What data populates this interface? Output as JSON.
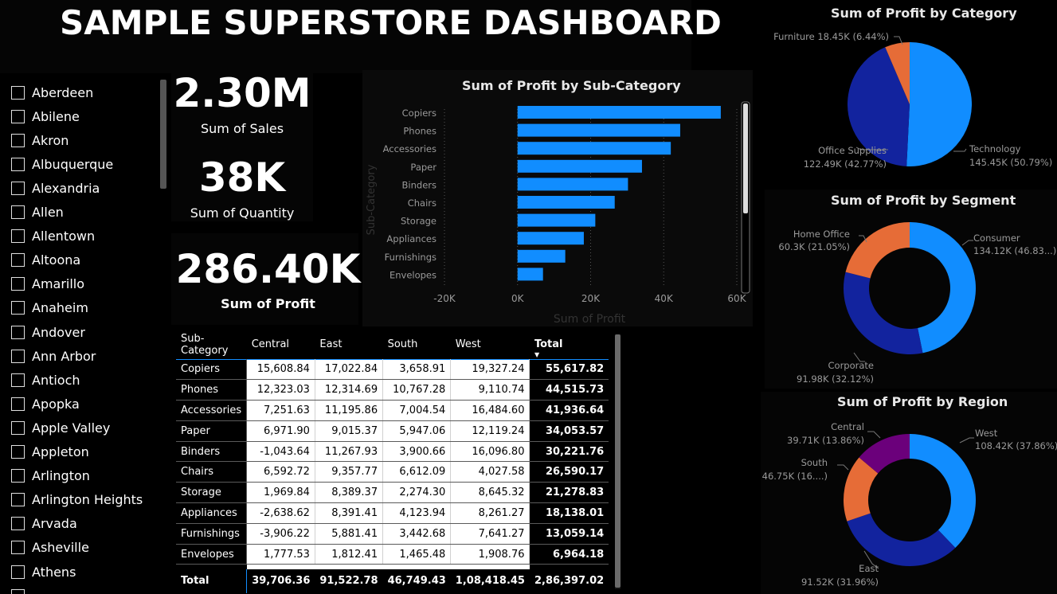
{
  "title": "SAMPLE SUPERSTORE DASHBOARD",
  "cities": [
    "Aberdeen",
    "Abilene",
    "Akron",
    "Albuquerque",
    "Alexandria",
    "Allen",
    "Allentown",
    "Altoona",
    "Amarillo",
    "Anaheim",
    "Andover",
    "Ann Arbor",
    "Antioch",
    "Apopka",
    "Apple Valley",
    "Appleton",
    "Arlington",
    "Arlington Heights",
    "Arvada",
    "Asheville",
    "Athens"
  ],
  "kpis": {
    "sales_value": "2.30M",
    "sales_label": "Sum of Sales",
    "quantity_value": "38K",
    "quantity_label": "Sum of Quantity",
    "profit_value": "286.40K",
    "profit_label": "Sum of Profit"
  },
  "colors": {
    "light_blue": "#118dff",
    "dark_blue": "#12239e",
    "orange": "#e66c37",
    "purple": "#6b007b",
    "background": "#000000"
  },
  "chart_data": [
    {
      "type": "bar",
      "title": "Sum of Profit by Sub-Category",
      "xlabel": "Sum of Profit",
      "ylabel": "Sub-Category",
      "categories": [
        "Copiers",
        "Phones",
        "Accessories",
        "Paper",
        "Binders",
        "Chairs",
        "Storage",
        "Appliances",
        "Furnishings",
        "Envelopes"
      ],
      "values": [
        55617.82,
        44515.73,
        41936.64,
        34053.57,
        30221.76,
        26590.17,
        21278.83,
        18138.01,
        13059.14,
        6964.18
      ],
      "xlim": [
        -20000,
        60000
      ],
      "xticks": [
        "-20K",
        "0K",
        "20K",
        "40K",
        "60K"
      ],
      "color": "#118dff"
    },
    {
      "type": "pie",
      "title": "Sum of Profit by Category",
      "slices": [
        {
          "name": "Technology",
          "value": 145450,
          "label": "Technology",
          "sublabel": "145.45K (50.79%)",
          "color": "#118dff"
        },
        {
          "name": "Office Supplies",
          "value": 122490,
          "label": "Office Supplies",
          "sublabel": "122.49K (42.77%)",
          "color": "#12239e"
        },
        {
          "name": "Furniture",
          "value": 18450,
          "label": "Furniture 18.45K (6.44%)",
          "sublabel": "",
          "color": "#e66c37"
        }
      ]
    },
    {
      "type": "pie",
      "title": "Sum of Profit by Segment",
      "donut": true,
      "slices": [
        {
          "name": "Consumer",
          "value": 134120,
          "label": "Consumer",
          "sublabel": "134.12K (46.83...)",
          "color": "#118dff"
        },
        {
          "name": "Corporate",
          "value": 91980,
          "label": "Corporate",
          "sublabel": "91.98K (32.12%)",
          "color": "#12239e"
        },
        {
          "name": "Home Office",
          "value": 60300,
          "label": "Home Office",
          "sublabel": "60.3K (21.05%)",
          "color": "#e66c37"
        }
      ]
    },
    {
      "type": "pie",
      "title": "Sum of Profit by Region",
      "donut": true,
      "slices": [
        {
          "name": "West",
          "value": 108420,
          "label": "West",
          "sublabel": "108.42K (37.86%)",
          "color": "#118dff"
        },
        {
          "name": "East",
          "value": 91520,
          "label": "East",
          "sublabel": "91.52K (31.96%)",
          "color": "#12239e"
        },
        {
          "name": "South",
          "value": 46750,
          "label": "South",
          "sublabel": "46.75K (16....)",
          "color": "#e66c37"
        },
        {
          "name": "Central",
          "value": 39710,
          "label": "Central",
          "sublabel": "39.71K (13.86%)",
          "color": "#6b007b"
        }
      ]
    },
    {
      "type": "table",
      "columns": [
        "Sub-Category",
        "Central",
        "East",
        "South",
        "West",
        "Total"
      ],
      "rows": [
        [
          "Copiers",
          "15,608.84",
          "17,022.84",
          "3,658.91",
          "19,327.24",
          "55,617.82"
        ],
        [
          "Phones",
          "12,323.03",
          "12,314.69",
          "10,767.28",
          "9,110.74",
          "44,515.73"
        ],
        [
          "Accessories",
          "7,251.63",
          "11,195.86",
          "7,004.54",
          "16,484.60",
          "41,936.64"
        ],
        [
          "Paper",
          "6,971.90",
          "9,015.37",
          "5,947.06",
          "12,119.24",
          "34,053.57"
        ],
        [
          "Binders",
          "-1,043.64",
          "11,267.93",
          "3,900.66",
          "16,096.80",
          "30,221.76"
        ],
        [
          "Chairs",
          "6,592.72",
          "9,357.77",
          "6,612.09",
          "4,027.58",
          "26,590.17"
        ],
        [
          "Storage",
          "1,969.84",
          "8,389.37",
          "2,274.30",
          "8,645.32",
          "21,278.83"
        ],
        [
          "Appliances",
          "-2,638.62",
          "8,391.41",
          "4,123.94",
          "8,261.27",
          "18,138.01"
        ],
        [
          "Furnishings",
          "-3,906.22",
          "5,881.41",
          "3,442.68",
          "7,641.27",
          "13,059.14"
        ],
        [
          "Envelopes",
          "1,777.53",
          "1,812.41",
          "1,465.48",
          "1,908.76",
          "6,964.18"
        ]
      ],
      "total_row": [
        "Total",
        "39,706.36",
        "91,522.78",
        "46,749.43",
        "1,08,418.45",
        "2,86,397.02"
      ]
    }
  ]
}
